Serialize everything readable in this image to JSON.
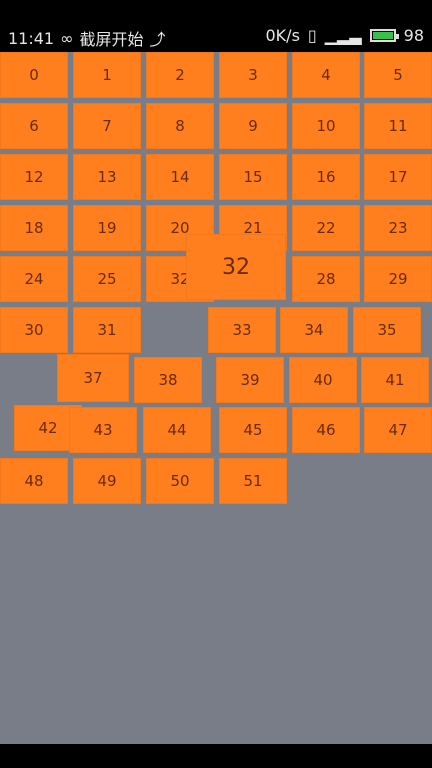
{
  "statusbar": {
    "time": "11:41",
    "title": "截屏开始",
    "speed": "0K/s",
    "battery": "98"
  },
  "tiles": [
    "0",
    "1",
    "2",
    "3",
    "4",
    "5",
    "6",
    "7",
    "8",
    "9",
    "10",
    "11",
    "12",
    "13",
    "14",
    "15",
    "16",
    "17",
    "18",
    "19",
    "20",
    "21",
    "22",
    "23",
    "24",
    "25",
    "32",
    "32",
    "28",
    "29",
    "30",
    "31",
    "33",
    "34",
    "35",
    "37",
    "38",
    "39",
    "40",
    "41",
    "42",
    "43",
    "44",
    "45",
    "46",
    "47",
    "48",
    "49",
    "50",
    "51"
  ]
}
